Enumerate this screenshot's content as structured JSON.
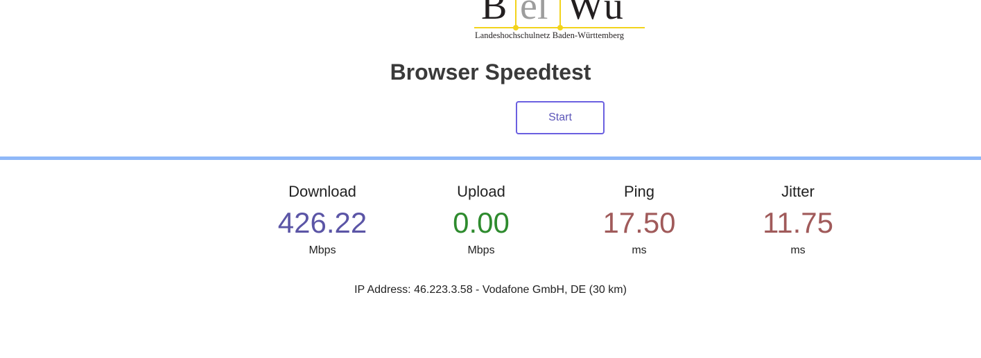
{
  "logo": {
    "letters": [
      "B",
      "el",
      "Wü"
    ],
    "tagline": "Landeshochschulnetz Baden-Württemberg"
  },
  "title": "Browser Speedtest",
  "start_button": {
    "label": "Start"
  },
  "colors": {
    "divider": "#8fb8f8",
    "download": "#5b55a6",
    "upload": "#2e8b2e",
    "ping": "#a05a5a",
    "jitter": "#a05a5a",
    "button_border": "#6a5fe0",
    "logo_accent": "#f2d31b"
  },
  "metrics": {
    "download": {
      "label": "Download",
      "value": "426.22",
      "unit": "Mbps"
    },
    "upload": {
      "label": "Upload",
      "value": "0.00",
      "unit": "Mbps"
    },
    "ping": {
      "label": "Ping",
      "value": "17.50",
      "unit": "ms"
    },
    "jitter": {
      "label": "Jitter",
      "value": "11.75",
      "unit": "ms"
    }
  },
  "ip_info": "IP Address: 46.223.3.58 - Vodafone GmbH, DE (30 km)"
}
